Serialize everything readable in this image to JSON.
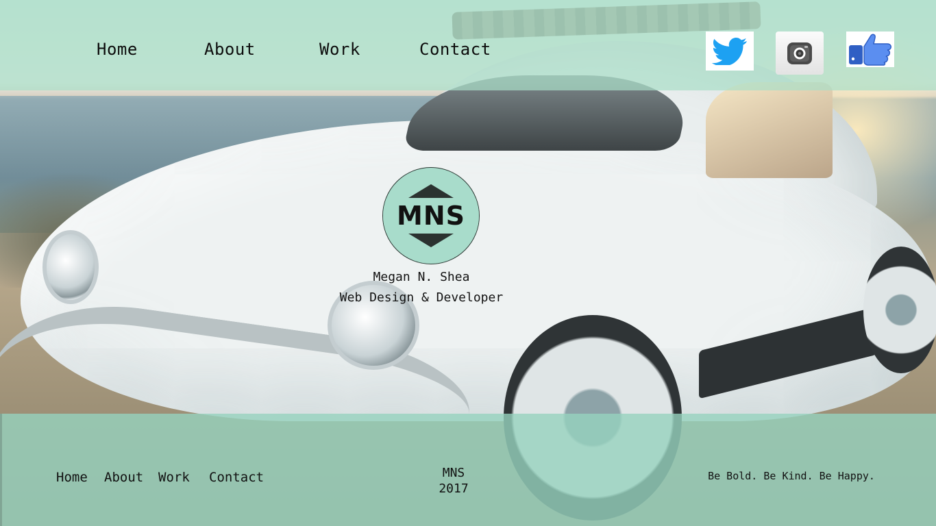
{
  "nav": {
    "home": "Home",
    "about": "About",
    "work": "Work",
    "contact": "Contact"
  },
  "social": [
    {
      "name": "twitter",
      "icon": "twitter-bird-icon",
      "color": "#1da1f2"
    },
    {
      "name": "instagram",
      "icon": "camera-icon",
      "color": "#4a4a4a"
    },
    {
      "name": "facebook",
      "icon": "thumbs-up-icon",
      "color": "#3b6fd8"
    }
  ],
  "hero": {
    "logo_text": "MNS",
    "name": "Megan N. Shea",
    "title": "Web Design & Developer"
  },
  "footer": {
    "nav": {
      "home": "Home",
      "about": "About",
      "work": "Work",
      "contact": "Contact"
    },
    "brand": "MNS",
    "year": "2017",
    "tagline": "Be Bold. Be Kind. Be Happy."
  },
  "colors": {
    "overlay_mint": "#aadec8",
    "logo_fill": "#a8dccb",
    "text": "#111111"
  }
}
